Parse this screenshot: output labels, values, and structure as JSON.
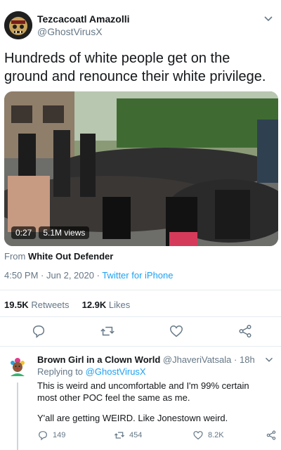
{
  "tweet": {
    "display_name": "Tezcacoatl Amazolli",
    "handle": "@GhostVirusX",
    "text": "Hundreds of white people get on the ground and renounce their white privilege.",
    "media": {
      "duration": "0:27",
      "views": "5.1M views"
    },
    "source_prefix": "From",
    "source_name": "White Out Defender",
    "time": "4:50 PM",
    "date": "Jun 2, 2020",
    "separator": "·",
    "client": "Twitter for iPhone",
    "retweets_count": "19.5K",
    "retweets_label": "Retweets",
    "likes_count": "12.9K",
    "likes_label": "Likes",
    "actions": [
      "reply-icon",
      "retweet-icon",
      "like-icon",
      "share-icon"
    ]
  },
  "reply": {
    "display_name": "Brown Girl in a Clown World",
    "handle": "@JhaveriVatsala",
    "age": "18h",
    "replying_prefix": "Replying to",
    "replying_to": "@GhostVirusX",
    "text_1": "This is weird and uncomfortable and I'm 99% certain most other POC feel the same as me.",
    "text_2": "Y'all are getting WEIRD. Like Jonestown weird.",
    "reply_count": "149",
    "retweet_count": "454",
    "like_count": "8.2K"
  },
  "colors": {
    "link": "#1da1f2",
    "secondary_text": "#657786",
    "primary_text": "#14171a",
    "divider": "#e6ecf0"
  }
}
